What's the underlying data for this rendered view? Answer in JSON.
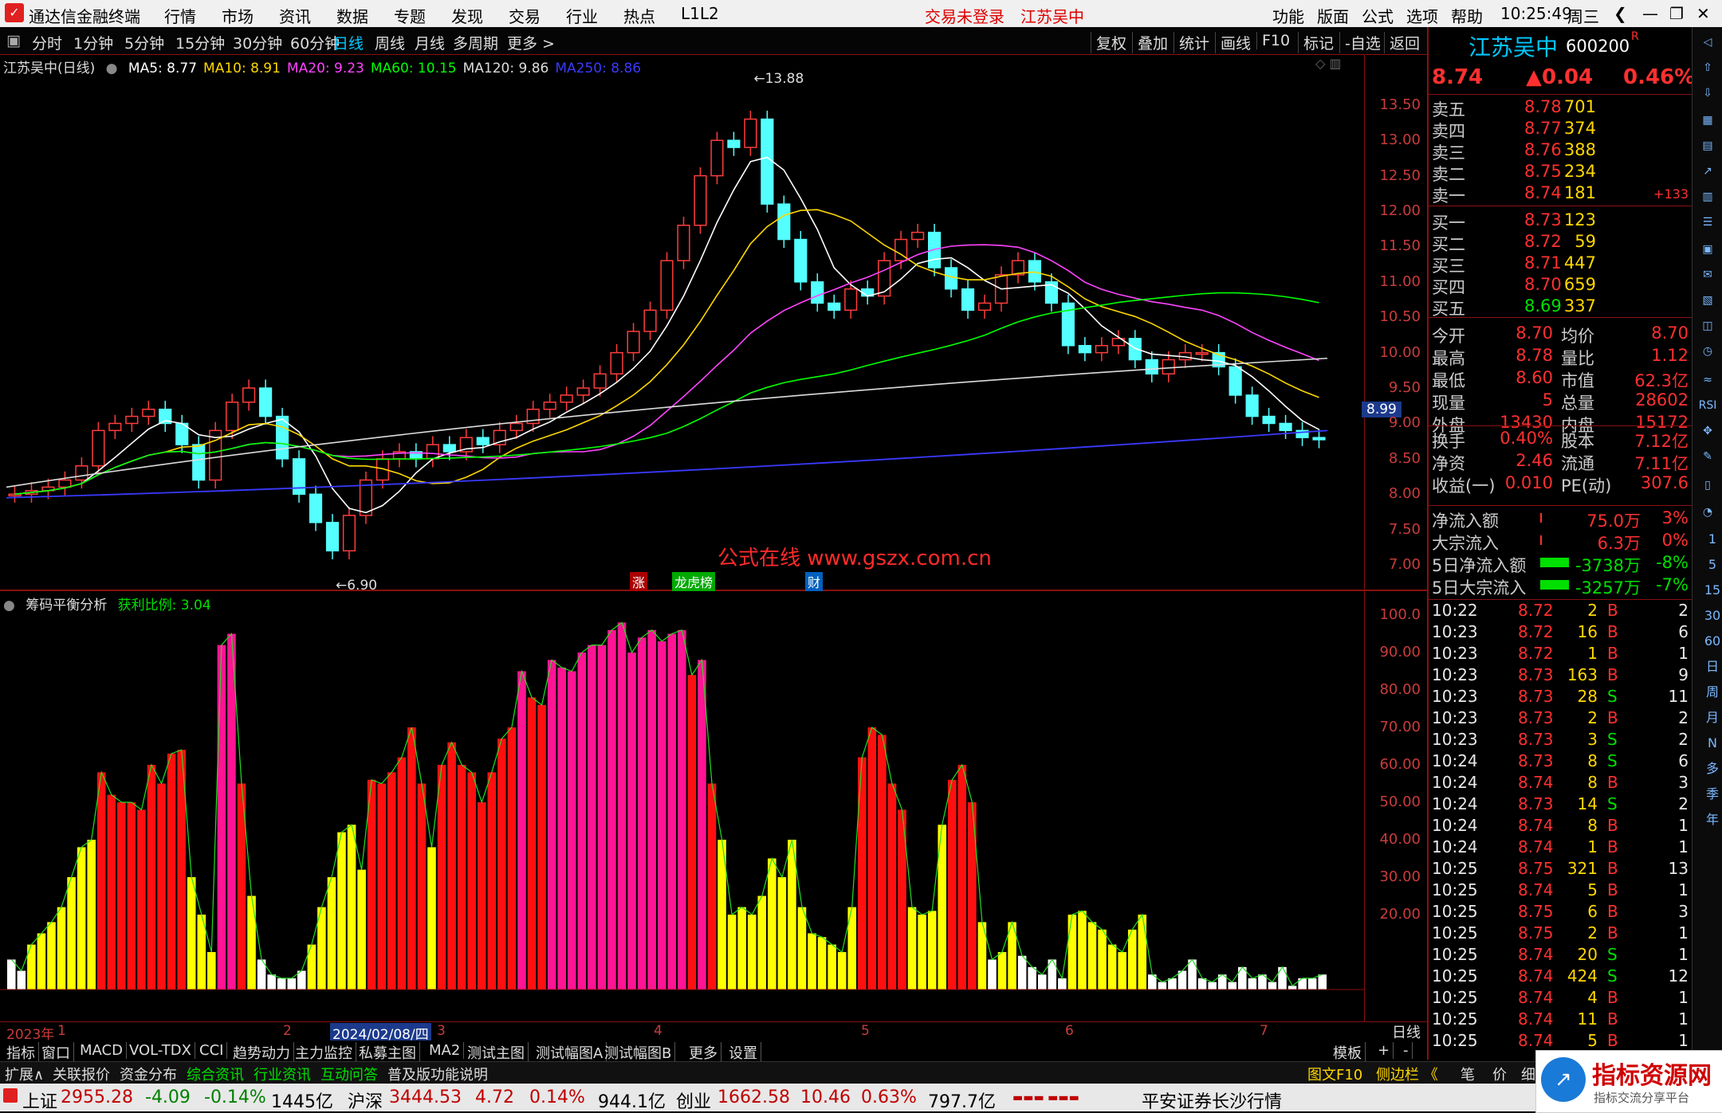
{
  "titlebar": {
    "app_title": "通达信金融终端",
    "menus": [
      "行情",
      "市场",
      "资讯",
      "数据",
      "专题",
      "发现",
      "交易",
      "行业",
      "热点",
      "L1L2"
    ],
    "trade_status": "交易未登录",
    "stock_name": "江苏吴中",
    "right_menus": [
      "功能",
      "版面",
      "公式",
      "选项",
      "帮助"
    ],
    "time": "10:25:49",
    "weekday": "周三"
  },
  "toolbar": {
    "periods": [
      "分时",
      "1分钟",
      "5分钟",
      "15分钟",
      "30分钟",
      "60分钟",
      "日线",
      "周线",
      "月线",
      "多周期",
      "更多 >"
    ],
    "active_period": "日线",
    "right_buttons": [
      "复权",
      "叠加",
      "统计",
      "画线",
      "F10",
      "标记",
      "-自选",
      "返回"
    ]
  },
  "main_chart": {
    "title": "江苏吴中(日线)",
    "ma_legend": [
      {
        "label": "MA5: 8.77",
        "color": "#ffffff"
      },
      {
        "label": "MA10: 8.91",
        "color": "#ffd700"
      },
      {
        "label": "MA20: 9.23",
        "color": "#ff44ff"
      },
      {
        "label": "MA60: 10.15",
        "color": "#00ff00"
      },
      {
        "label": "MA120: 9.86",
        "color": "#dddddd"
      },
      {
        "label": "MA250: 8.86",
        "color": "#3a3aff"
      }
    ],
    "y_ticks": [
      "13.50",
      "13.00",
      "12.50",
      "12.00",
      "11.50",
      "11.00",
      "10.50",
      "10.00",
      "9.50",
      "9.00",
      "8.50",
      "8.00",
      "7.50",
      "7.00"
    ],
    "current_price_tag": "8.99",
    "high_marker": "13.88",
    "low_marker": "6.90",
    "watermark_text": "公式在线  www.gszx.com.cn",
    "event_tags": [
      "涨",
      "龙虎榜",
      "财"
    ]
  },
  "sub_chart": {
    "title": "筹码平衡分析",
    "indicator": "获利比例: 3.04",
    "y_ticks": [
      "100.0",
      "90.00",
      "80.00",
      "70.00",
      "60.00",
      "50.00",
      "40.00",
      "30.00",
      "20.00"
    ],
    "x_labels": [
      "2023年",
      "1",
      "2",
      "2024/02/08/四",
      "3",
      "4",
      "5",
      "6",
      "7"
    ],
    "period_label": "日线"
  },
  "chart_data": [
    {
      "type": "candlestick",
      "title": "江苏吴中(日线)",
      "ylim": [
        6.9,
        13.88
      ],
      "series": [
        {
          "name": "close",
          "values": [
            8.0,
            8.05,
            8.1,
            8.2,
            8.4,
            8.9,
            9.0,
            9.1,
            9.2,
            9.0,
            8.7,
            8.2,
            8.9,
            9.3,
            9.5,
            9.1,
            8.5,
            8.0,
            7.6,
            7.2,
            7.7,
            8.2,
            8.5,
            8.6,
            8.5,
            8.7,
            8.6,
            8.8,
            8.7,
            8.9,
            9.0,
            9.2,
            9.3,
            9.4,
            9.5,
            9.7,
            10.0,
            10.3,
            10.6,
            11.3,
            11.8,
            12.5,
            13.0,
            12.9,
            13.3,
            12.1,
            11.6,
            11.0,
            10.7,
            10.6,
            10.9,
            10.8,
            11.3,
            11.6,
            11.7,
            11.2,
            10.9,
            10.6,
            10.7,
            11.1,
            11.3,
            11.0,
            10.7,
            10.1,
            10.0,
            10.1,
            10.2,
            9.9,
            9.7,
            9.9,
            10.0,
            10.0,
            9.8,
            9.4,
            9.1,
            9.0,
            8.9,
            8.8,
            8.77
          ]
        }
      ]
    },
    {
      "type": "bar",
      "title": "筹码平衡分析",
      "ylim": [
        0,
        100
      ],
      "series": [
        {
          "name": "获利比例",
          "values": [
            8,
            5,
            12,
            15,
            18,
            22,
            30,
            38,
            40,
            58,
            52,
            50,
            50,
            48,
            60,
            55,
            63,
            64,
            30,
            20,
            10,
            92,
            95,
            55,
            25,
            8,
            4,
            3,
            3,
            5,
            12,
            22,
            30,
            42,
            44,
            32,
            56,
            55,
            58,
            62,
            70,
            55,
            38,
            60,
            66,
            60,
            58,
            50,
            58,
            67,
            70,
            85,
            78,
            76,
            88,
            86,
            85,
            90,
            92,
            92,
            96,
            98,
            90,
            94,
            96,
            93,
            95,
            96,
            84,
            88,
            55,
            40,
            20,
            22,
            20,
            25,
            35,
            30,
            40,
            22,
            15,
            14,
            12,
            10,
            22,
            62,
            70,
            68,
            55,
            48,
            22,
            20,
            21,
            44,
            56,
            60,
            50,
            18,
            8,
            10,
            18,
            9,
            6,
            4,
            8,
            3,
            20,
            21,
            18,
            16,
            12,
            10,
            16,
            20,
            4,
            2,
            3,
            5,
            8,
            3,
            2,
            4,
            2,
            6,
            3,
            4,
            2,
            6,
            1,
            3,
            3,
            4
          ]
        }
      ]
    }
  ],
  "quote": {
    "name": "江苏吴中",
    "code": "600200",
    "r_tag": "R",
    "price": "8.74",
    "change": "▲0.04",
    "change_pct": "0.46%",
    "sell": [
      {
        "label": "卖五",
        "price": "8.78",
        "vol": "701"
      },
      {
        "label": "卖四",
        "price": "8.77",
        "vol": "374"
      },
      {
        "label": "卖三",
        "price": "8.76",
        "vol": "388"
      },
      {
        "label": "卖二",
        "price": "8.75",
        "vol": "234"
      },
      {
        "label": "卖一",
        "price": "8.74",
        "vol": "181",
        "delta": "+133"
      }
    ],
    "buy": [
      {
        "label": "买一",
        "price": "8.73",
        "vol": "123"
      },
      {
        "label": "买二",
        "price": "8.72",
        "vol": "59"
      },
      {
        "label": "买三",
        "price": "8.71",
        "vol": "447"
      },
      {
        "label": "买四",
        "price": "8.70",
        "vol": "659"
      },
      {
        "label": "买五",
        "price": "8.69",
        "vol": "337"
      }
    ],
    "stats": [
      {
        "l1": "今开",
        "v1": "8.70",
        "l2": "均价",
        "v2": "8.70"
      },
      {
        "l1": "最高",
        "v1": "8.78",
        "l2": "量比",
        "v2": "1.12"
      },
      {
        "l1": "最低",
        "v1": "8.60",
        "l2": "市值",
        "v2": "62.3亿"
      },
      {
        "l1": "现量",
        "v1": "5",
        "l2": "总量",
        "v2": "28602"
      },
      {
        "l1": "外盘",
        "v1": "13430",
        "l2": "内盘",
        "v2": "15172"
      }
    ],
    "stats2": [
      {
        "l1": "换手",
        "v1": "0.40%",
        "l2": "股本",
        "v2": "7.12亿"
      },
      {
        "l1": "净资",
        "v1": "2.46",
        "l2": "流通",
        "v2": "7.11亿"
      },
      {
        "l1": "收益(一)",
        "v1": "0.010",
        "l2": "PE(动)",
        "v2": "307.6"
      }
    ],
    "flows": [
      {
        "label": "净流入额",
        "value": "75.0万",
        "pct": "3%"
      },
      {
        "label": "大宗流入",
        "value": "6.3万",
        "pct": "0%"
      },
      {
        "label": "5日净流入额",
        "value": "-3738万",
        "pct": "-8%"
      },
      {
        "label": "5日大宗流入",
        "value": "-3257万",
        "pct": "-7%"
      }
    ],
    "ticks": [
      [
        "10:22",
        "8.72",
        "2",
        "B",
        "2"
      ],
      [
        "10:23",
        "8.72",
        "16",
        "B",
        "6"
      ],
      [
        "10:23",
        "8.72",
        "1",
        "B",
        "1"
      ],
      [
        "10:23",
        "8.73",
        "163",
        "B",
        "9"
      ],
      [
        "10:23",
        "8.73",
        "28",
        "S",
        "11"
      ],
      [
        "10:23",
        "8.73",
        "2",
        "B",
        "2"
      ],
      [
        "10:23",
        "8.73",
        "3",
        "S",
        "2"
      ],
      [
        "10:24",
        "8.73",
        "8",
        "S",
        "6"
      ],
      [
        "10:24",
        "8.74",
        "8",
        "B",
        "3"
      ],
      [
        "10:24",
        "8.73",
        "14",
        "S",
        "2"
      ],
      [
        "10:24",
        "8.74",
        "8",
        "B",
        "1"
      ],
      [
        "10:24",
        "8.74",
        "1",
        "B",
        "1"
      ],
      [
        "10:25",
        "8.75",
        "321",
        "B",
        "13"
      ],
      [
        "10:25",
        "8.74",
        "5",
        "B",
        "1"
      ],
      [
        "10:25",
        "8.75",
        "6",
        "B",
        "3"
      ],
      [
        "10:25",
        "8.75",
        "2",
        "B",
        "1"
      ],
      [
        "10:25",
        "8.74",
        "20",
        "S",
        "1"
      ],
      [
        "10:25",
        "8.74",
        "424",
        "S",
        "12"
      ],
      [
        "10:25",
        "8.74",
        "4",
        "B",
        "1"
      ],
      [
        "10:25",
        "8.74",
        "11",
        "B",
        "1"
      ],
      [
        "10:25",
        "8.74",
        "5",
        "B",
        "1"
      ]
    ]
  },
  "iconbar": {
    "labels": [
      "1",
      "5",
      "15",
      "30",
      "60",
      "日",
      "周",
      "月",
      "N",
      "多",
      "季",
      "年"
    ]
  },
  "bottom_tabs": [
    "指标",
    "窗口",
    "MACD",
    "VOL-TDX",
    "CCI",
    "趋势动力",
    "主力监控",
    "私募主图",
    "MA2",
    "测试主图",
    "测试幅图A",
    "测试幅图B",
    "更多",
    "设置"
  ],
  "bottom_right": [
    "模板",
    "+",
    "-"
  ],
  "bottom_tabs2": [
    "扩展∧",
    "关联报价",
    "资金分布",
    "综合资讯",
    "行业资讯",
    "互动问答",
    "普及版功能说明"
  ],
  "bottom_tabs2_right": [
    "图文F10",
    "侧边栏 《",
    "笔",
    "价",
    "细"
  ],
  "status": {
    "indices": [
      {
        "name": "上证",
        "value": "2955.28",
        "chg": "-4.09",
        "pct": "-0.14%",
        "amt": "1445亿"
      },
      {
        "name": "沪深",
        "value": "3444.53",
        "chg": "4.72",
        "pct": "0.14%",
        "amt": "944.1亿"
      },
      {
        "name": "创业",
        "value": "1662.58",
        "chg": "10.46",
        "pct": "0.63%",
        "amt": "797.7亿"
      }
    ],
    "broker": "平安证券长沙行情"
  },
  "corner_watermark": {
    "title": "指标资源网",
    "sub": "指标交流分享平台"
  }
}
